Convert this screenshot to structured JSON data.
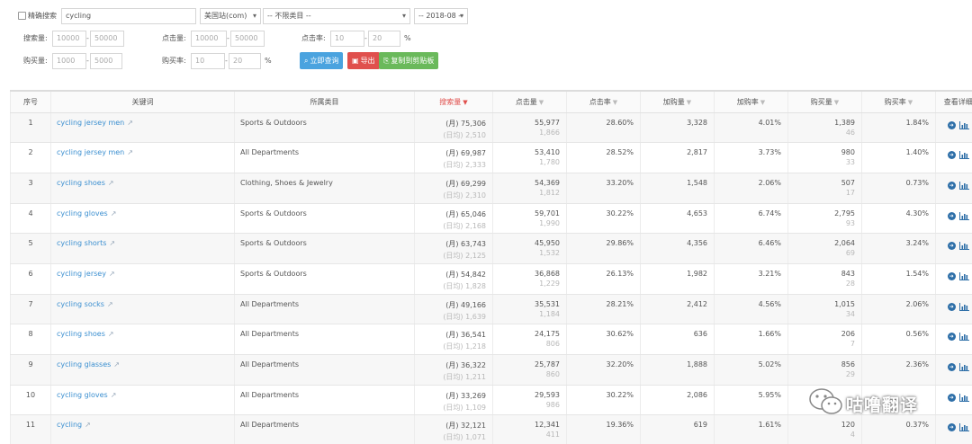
{
  "filters": {
    "exact_search_label": "精确搜索",
    "keyword_value": "cycling",
    "site": "美国站(com)",
    "category": "-- 不限类目 --",
    "month": "-- 2018-08 --",
    "search_volume_label": "搜索量:",
    "search_min": "10000",
    "search_max": "50000",
    "clicks_label": "点击量:",
    "clicks_min": "10000",
    "clicks_max": "50000",
    "ctr_label": "点击率:",
    "ctr_min": "10",
    "ctr_max": "20",
    "purchases_label": "购买量:",
    "purchases_min": "1000",
    "purchases_max": "5000",
    "cvr_label": "购买率:",
    "cvr_min": "10",
    "cvr_max": "20",
    "percent": "%",
    "dash": "-",
    "query_button": "立即查询",
    "export_button": "导出",
    "copy_button": "复制到剪贴板"
  },
  "table": {
    "headers": {
      "index": "序号",
      "keyword": "关键词",
      "category": "所属类目",
      "search": "搜索量",
      "clicks": "点击量",
      "ctr": "点击率",
      "carts": "加购量",
      "cart_rate": "加购率",
      "purchases": "购买量",
      "purchase_rate": "购买率",
      "detail": "查看详细"
    },
    "rows": [
      {
        "i": "1",
        "kw": "cycling jersey men",
        "cat": "Sports & Outdoors",
        "sm": "(月) 75,306",
        "sd": "(日均) 2,510",
        "c": "55,977",
        "cd": "1,866",
        "ctr": "28.60%",
        "ca": "3,328",
        "cr": "4.01%",
        "p": "1,389",
        "pd": "46",
        "pr": "1.84%"
      },
      {
        "i": "2",
        "kw": "cycling jersey men",
        "cat": "All Departments",
        "sm": "(月) 69,987",
        "sd": "(日均) 2,333",
        "c": "53,410",
        "cd": "1,780",
        "ctr": "28.52%",
        "ca": "2,817",
        "cr": "3.73%",
        "p": "980",
        "pd": "33",
        "pr": "1.40%"
      },
      {
        "i": "3",
        "kw": "cycling shoes",
        "cat": "Clothing, Shoes & Jewelry",
        "sm": "(月) 69,299",
        "sd": "(日均) 2,310",
        "c": "54,369",
        "cd": "1,812",
        "ctr": "33.20%",
        "ca": "1,548",
        "cr": "2.06%",
        "p": "507",
        "pd": "17",
        "pr": "0.73%"
      },
      {
        "i": "4",
        "kw": "cycling gloves",
        "cat": "Sports & Outdoors",
        "sm": "(月) 65,046",
        "sd": "(日均) 2,168",
        "c": "59,701",
        "cd": "1,990",
        "ctr": "30.22%",
        "ca": "4,653",
        "cr": "6.74%",
        "p": "2,795",
        "pd": "93",
        "pr": "4.30%"
      },
      {
        "i": "5",
        "kw": "cycling shorts",
        "cat": "Sports & Outdoors",
        "sm": "(月) 63,743",
        "sd": "(日均) 2,125",
        "c": "45,950",
        "cd": "1,532",
        "ctr": "29.86%",
        "ca": "4,356",
        "cr": "6.46%",
        "p": "2,064",
        "pd": "69",
        "pr": "3.24%"
      },
      {
        "i": "6",
        "kw": "cycling jersey",
        "cat": "Sports & Outdoors",
        "sm": "(月) 54,842",
        "sd": "(日均) 1,828",
        "c": "36,868",
        "cd": "1,229",
        "ctr": "26.13%",
        "ca": "1,982",
        "cr": "3.21%",
        "p": "843",
        "pd": "28",
        "pr": "1.54%"
      },
      {
        "i": "7",
        "kw": "cycling socks",
        "cat": "All Departments",
        "sm": "(月) 49,166",
        "sd": "(日均) 1,639",
        "c": "35,531",
        "cd": "1,184",
        "ctr": "28.21%",
        "ca": "2,412",
        "cr": "4.56%",
        "p": "1,015",
        "pd": "34",
        "pr": "2.06%"
      },
      {
        "i": "8",
        "kw": "cycling shoes",
        "cat": "All Departments",
        "sm": "(月) 36,541",
        "sd": "(日均) 1,218",
        "c": "24,175",
        "cd": "806",
        "ctr": "30.62%",
        "ca": "636",
        "cr": "1.66%",
        "p": "206",
        "pd": "7",
        "pr": "0.56%"
      },
      {
        "i": "9",
        "kw": "cycling glasses",
        "cat": "All Departments",
        "sm": "(月) 36,322",
        "sd": "(日均) 1,211",
        "c": "25,787",
        "cd": "860",
        "ctr": "32.20%",
        "ca": "1,888",
        "cr": "5.02%",
        "p": "856",
        "pd": "29",
        "pr": "2.36%"
      },
      {
        "i": "10",
        "kw": "cycling gloves",
        "cat": "All Departments",
        "sm": "(月) 33,269",
        "sd": "(日均) 1,109",
        "c": "29,593",
        "cd": "986",
        "ctr": "30.22%",
        "ca": "2,086",
        "cr": "5.95%",
        "p": "",
        "pd": "",
        "pr": ""
      },
      {
        "i": "11",
        "kw": "cycling",
        "cat": "All Departments",
        "sm": "(月) 32,121",
        "sd": "(日均) 1,071",
        "c": "12,341",
        "cd": "411",
        "ctr": "19.36%",
        "ca": "619",
        "cr": "1.61%",
        "p": "120",
        "pd": "4",
        "pr": "0.37%"
      }
    ]
  },
  "watermark": {
    "text": "咕噜翻译",
    "icon": "wechat-icon"
  },
  "colors": {
    "link": "#3b8fd0",
    "active_sort": "#e0504d",
    "query": "#4aa3df",
    "export": "#e0504d",
    "copy": "#6ab95b"
  }
}
